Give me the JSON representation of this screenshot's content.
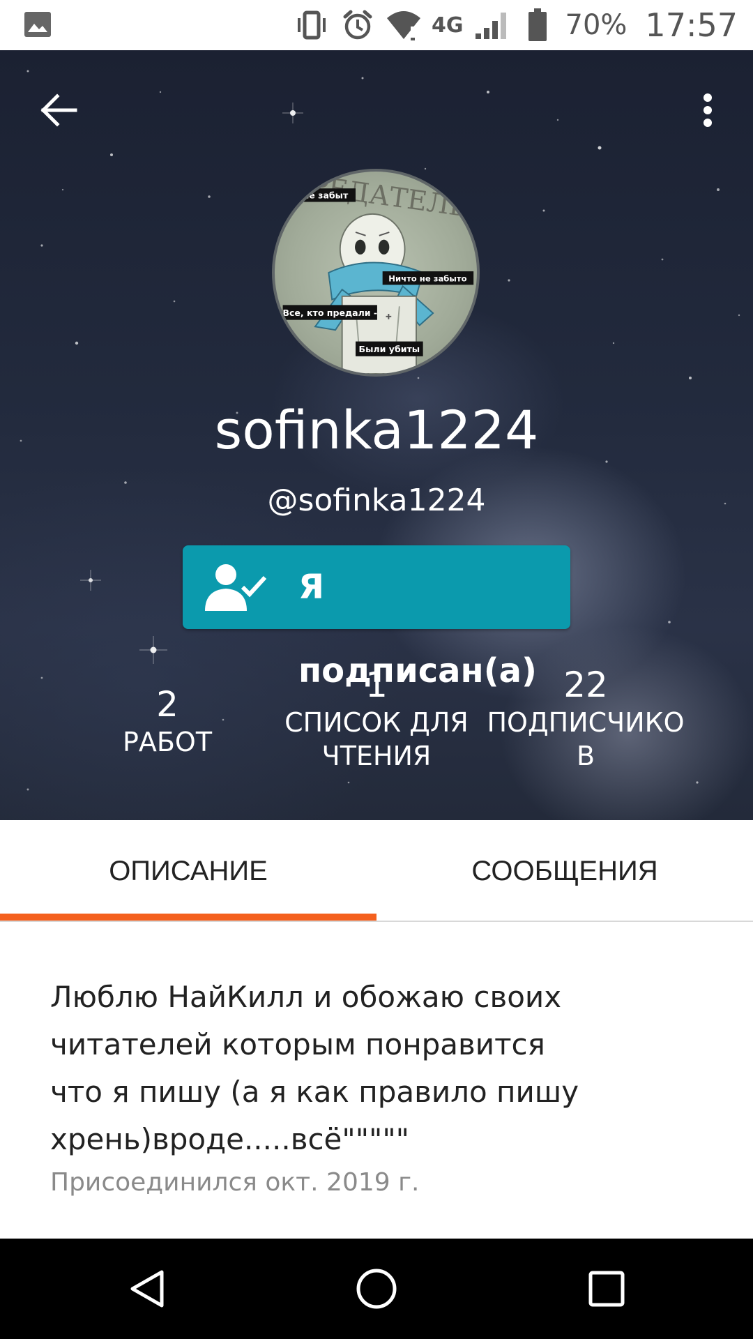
{
  "status_bar": {
    "battery": "70%",
    "time": "17:57",
    "network": "4G",
    "icons": [
      "gallery-icon",
      "vibrate-icon",
      "alarm-icon",
      "wifi-icon",
      "signal-icon",
      "battery-icon"
    ]
  },
  "header": {
    "back_icon": "arrow-left-icon",
    "menu_icon": "more-vert-icon",
    "avatar_texts": [
      "то не забыт",
      "ПРЕДАТЕЛЬ",
      "Ничто не забыто",
      "Все, кто предали -",
      "Были убиты"
    ],
    "display_name": "sofinka1224",
    "handle": "@sofinka1224",
    "follow_button": {
      "label": "Я подписан(а)",
      "icon": "person-check-icon",
      "color": "#0b9aad"
    }
  },
  "stats": [
    {
      "value": "2",
      "label": "РАБОТ"
    },
    {
      "value": "1",
      "label_line1": "СПИСОК ДЛЯ",
      "label_line2": "ЧТЕНИЯ"
    },
    {
      "value": "22",
      "label_line1": "ПОДПИСЧИКО",
      "label_line2": "В"
    }
  ],
  "tabs": [
    {
      "label": "ОПИСАНИЕ",
      "active": true
    },
    {
      "label": "СООБЩЕНИЯ",
      "active": false
    }
  ],
  "accent_color": "#f4601e",
  "about": {
    "lines": [
      "Люблю НайКилл и обожаю своих",
      "читателей которым понравится",
      "что я пишу (а я как правило пишу",
      "хрень)вроде.....всё\"\"\"\"\""
    ],
    "joined": "Присоединился окт. 2019 г."
  },
  "nav_bar": {
    "icons": [
      "nav-back-icon",
      "nav-home-icon",
      "nav-recents-icon"
    ]
  }
}
